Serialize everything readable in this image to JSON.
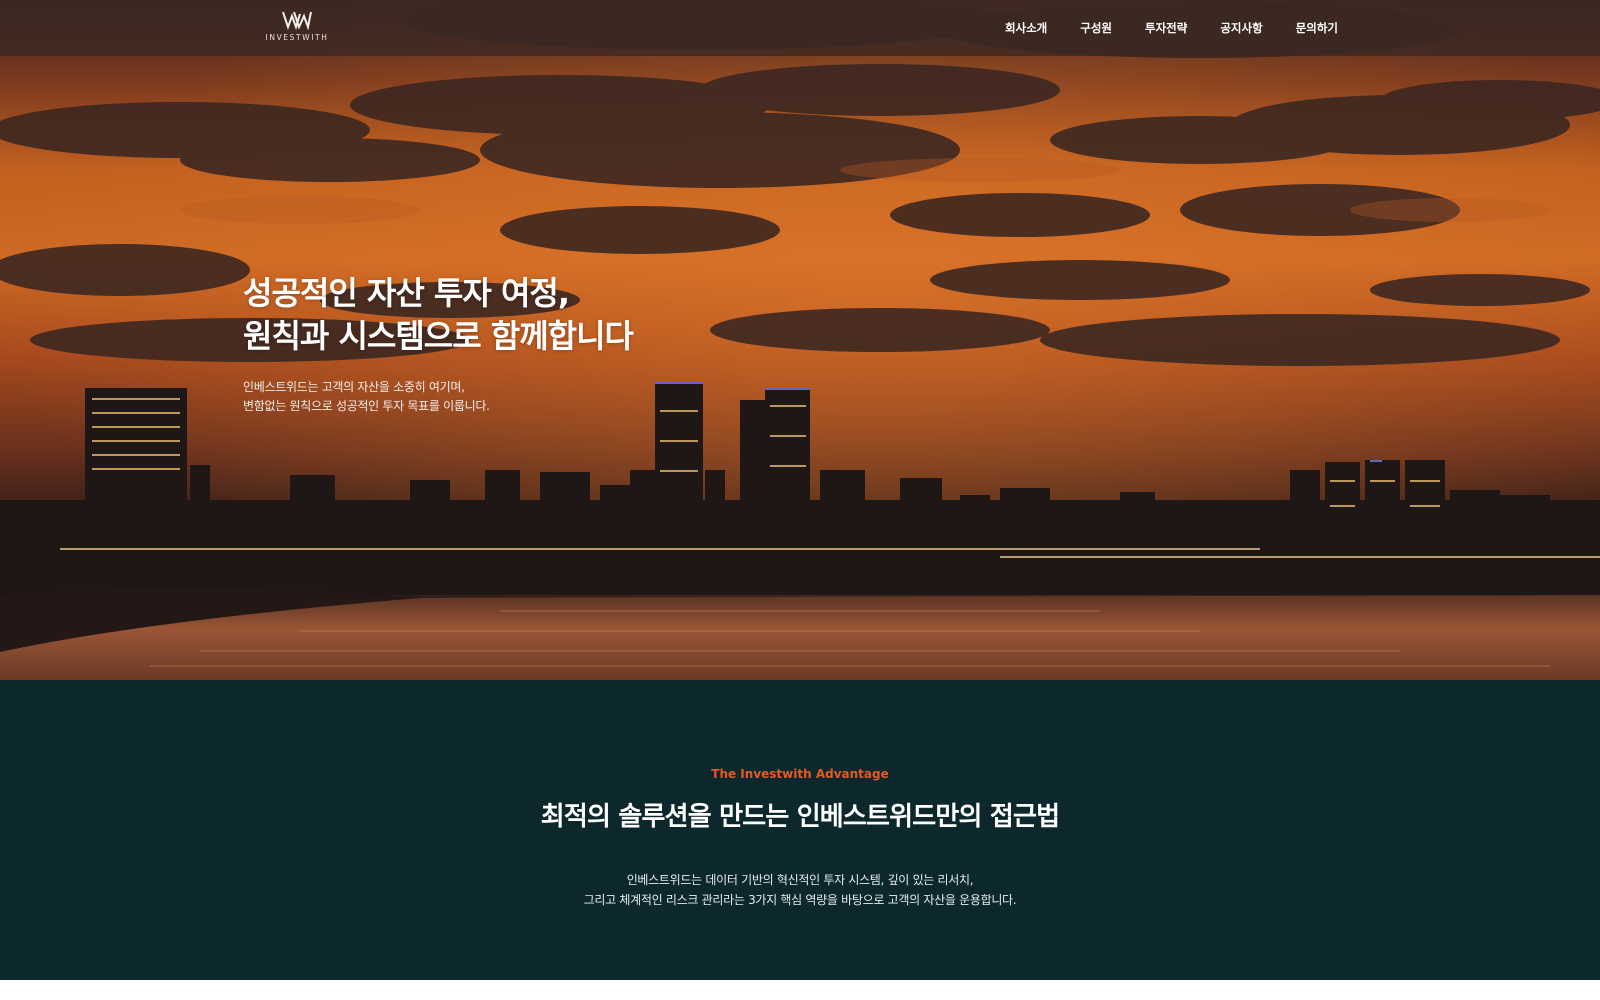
{
  "brand": {
    "logo_alt": "WV",
    "name": "INVESTWITH"
  },
  "nav": {
    "items": [
      {
        "label": "회사소개"
      },
      {
        "label": "구성원"
      },
      {
        "label": "투자전략"
      },
      {
        "label": "공지사항"
      },
      {
        "label": "문의하기"
      }
    ]
  },
  "hero": {
    "title_line1": "성공적인 자산 투자 여정,",
    "title_line2": "원칙과 시스템으로 함께합니다",
    "desc_line1": "인베스트위드는 고객의 자산을 소중히 여기며,",
    "desc_line2": "변함없는 원칙으로 성공적인 투자 목표를 이룹니다."
  },
  "advantage": {
    "eyebrow": "The Investwith Advantage",
    "title": "최적의 솔루션을 만드는 인베스트위드만의 접근법",
    "desc_line1": "인베스트위드는 데이터 기반의 혁신적인 투자 시스템, 깊이 있는 리서치,",
    "desc_line2": "그리고 체계적인 리스크 관리라는 3가지 핵심 역량을 바탕으로 고객의 자산을 운용합니다."
  },
  "colors": {
    "accent": "#e65a22",
    "section_bg": "#0c282d",
    "header_bg": "#3c2822"
  }
}
